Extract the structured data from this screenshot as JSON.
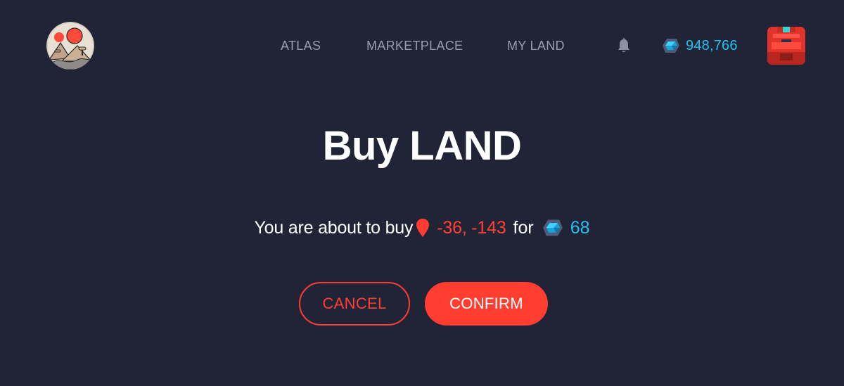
{
  "colors": {
    "background": "#212436",
    "accent": "#ff3d30",
    "mana": "#24c1ef",
    "nav_text": "#9a9db0"
  },
  "header": {
    "logo_icon": "decentraland-logo-icon",
    "nav": {
      "atlas": "ATLAS",
      "marketplace": "MARKETPLACE",
      "my_land": "MY LAND"
    },
    "notifications_icon": "bell-icon",
    "balance": {
      "icon": "mana-icon",
      "value": "948,766"
    },
    "avatar_icon": "user-avatar-icon"
  },
  "main": {
    "title": "Buy LAND",
    "message": {
      "prefix": "You are about to buy",
      "location_icon": "map-pin-icon",
      "coords": "-36, -143",
      "conjunction": "for",
      "price_icon": "mana-icon",
      "price": "68"
    },
    "buttons": {
      "cancel": "CANCEL",
      "confirm": "CONFIRM"
    }
  }
}
